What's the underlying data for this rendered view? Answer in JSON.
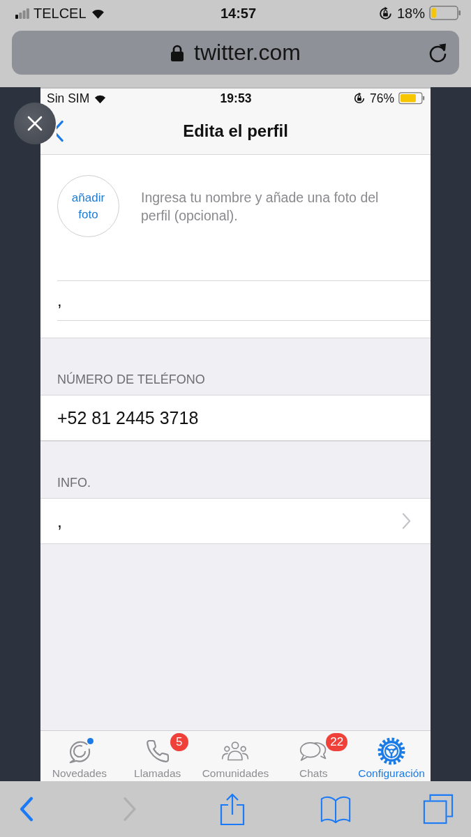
{
  "browser_status_bar": {
    "carrier": "TELCEL",
    "time": "14:57",
    "battery_percent": "18%"
  },
  "address_bar": {
    "url": "twitter.com"
  },
  "app_status_bar": {
    "carrier": "Sin SIM",
    "time": "19:53",
    "battery_percent": "76%"
  },
  "nav_bar": {
    "title": "Edita el perfil"
  },
  "profile": {
    "photo_button": "añadir foto",
    "hint": "Ingresa tu nombre y añade una foto del perfil (opcional).",
    "name_value": ","
  },
  "sections": [
    {
      "header": "NÚMERO DE TELÉFONO",
      "value": "+52 81 2445 3718",
      "kind": "plain"
    },
    {
      "header": "INFO.",
      "value": ",",
      "kind": "disclosure"
    }
  ],
  "tab_bar": [
    {
      "label": "Novedades",
      "kind": "updates",
      "selected": false,
      "dot": true
    },
    {
      "label": "Llamadas",
      "kind": "calls",
      "selected": false,
      "dot": false,
      "badge": "5"
    },
    {
      "label": "Comunidades",
      "kind": "communities",
      "selected": false,
      "dot": false
    },
    {
      "label": "Chats",
      "kind": "chats",
      "selected": false,
      "dot": false,
      "badge": "22"
    },
    {
      "label": "Configuración",
      "kind": "settings",
      "selected": true,
      "dot": false
    }
  ],
  "browser_toolbar": [
    {
      "kind": "back",
      "disabled": false
    },
    {
      "kind": "forward",
      "disabled": true
    },
    {
      "kind": "share",
      "disabled": false
    },
    {
      "kind": "bookmarks",
      "disabled": false
    },
    {
      "kind": "tabs",
      "disabled": false
    }
  ]
}
